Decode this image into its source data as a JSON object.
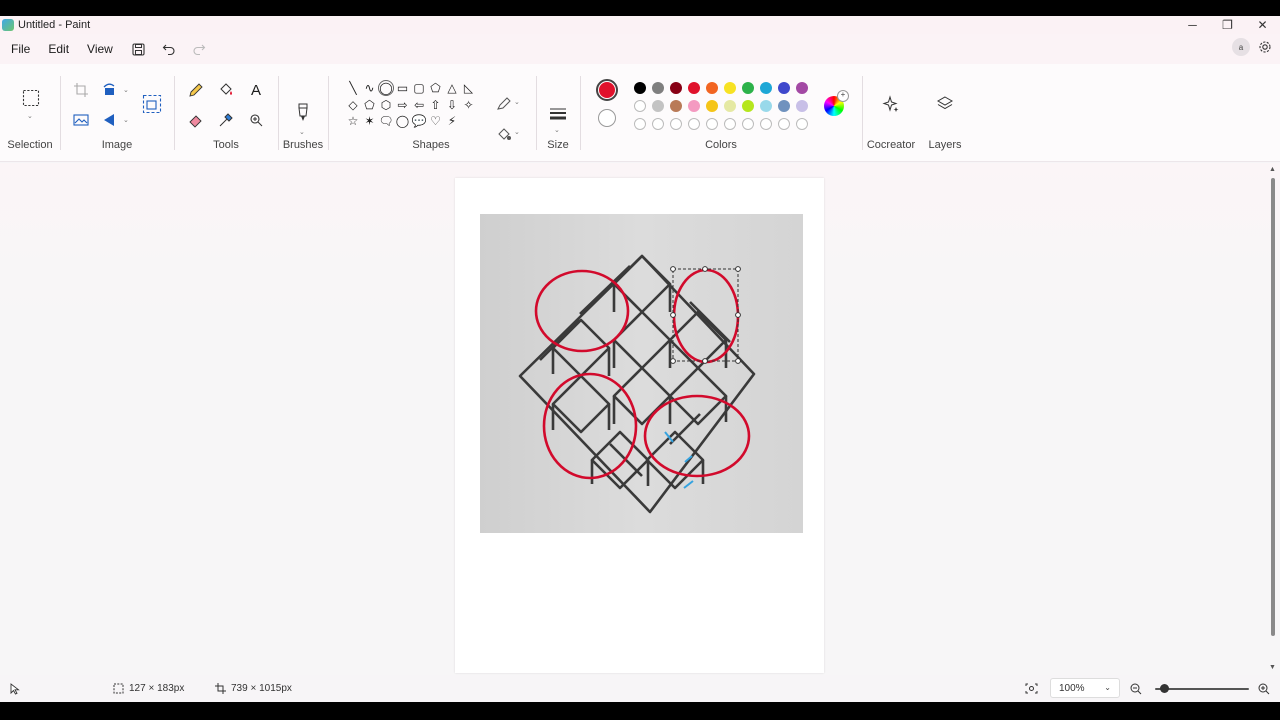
{
  "window": {
    "title": "Untitled - Paint",
    "controls": {
      "minimize": "─",
      "maximize": "❐",
      "close": "✕"
    }
  },
  "menu": {
    "items": [
      "File",
      "Edit",
      "View"
    ]
  },
  "user": {
    "avatar_initial": "a"
  },
  "ribbon": {
    "groups": {
      "selection": "Selection",
      "image": "Image",
      "tools": "Tools",
      "brushes": "Brushes",
      "shapes": "Shapes",
      "size": "Size",
      "colors": "Colors",
      "cocreator": "Cocreator",
      "layers": "Layers"
    },
    "shapes": [
      "╲",
      "∿",
      "◯",
      "▭",
      "▢",
      "⬠",
      "△",
      "◺",
      "◇",
      "⬠",
      "⬡",
      "⇨",
      "⇦",
      "⇧",
      "⇩",
      "✧",
      "☆",
      "✶",
      "🗨",
      "◯",
      "💬",
      "♡",
      "⚡"
    ],
    "colors": {
      "primary": "#e0112b",
      "secondary": "#ffffff",
      "row1": [
        "#000000",
        "#7f7f7f",
        "#880015",
        "#e0112b",
        "#f26522",
        "#f7e223",
        "#2db24a",
        "#1ea7d6",
        "#3f48cc",
        "#a349a4"
      ],
      "row2": [
        "#ffffff",
        "#c3c3c3",
        "#b97a57",
        "#f49ac1",
        "#f5c518",
        "#e5e9a3",
        "#b5e61d",
        "#99d9ea",
        "#7092be",
        "#c8bfe7"
      ],
      "row3": [
        "",
        "",
        "",
        "",
        "",
        "",
        "",
        "",
        "",
        ""
      ]
    }
  },
  "status": {
    "selection_size": "127 × 183px",
    "canvas_size": "739 × 1015px",
    "zoom": "100%"
  }
}
